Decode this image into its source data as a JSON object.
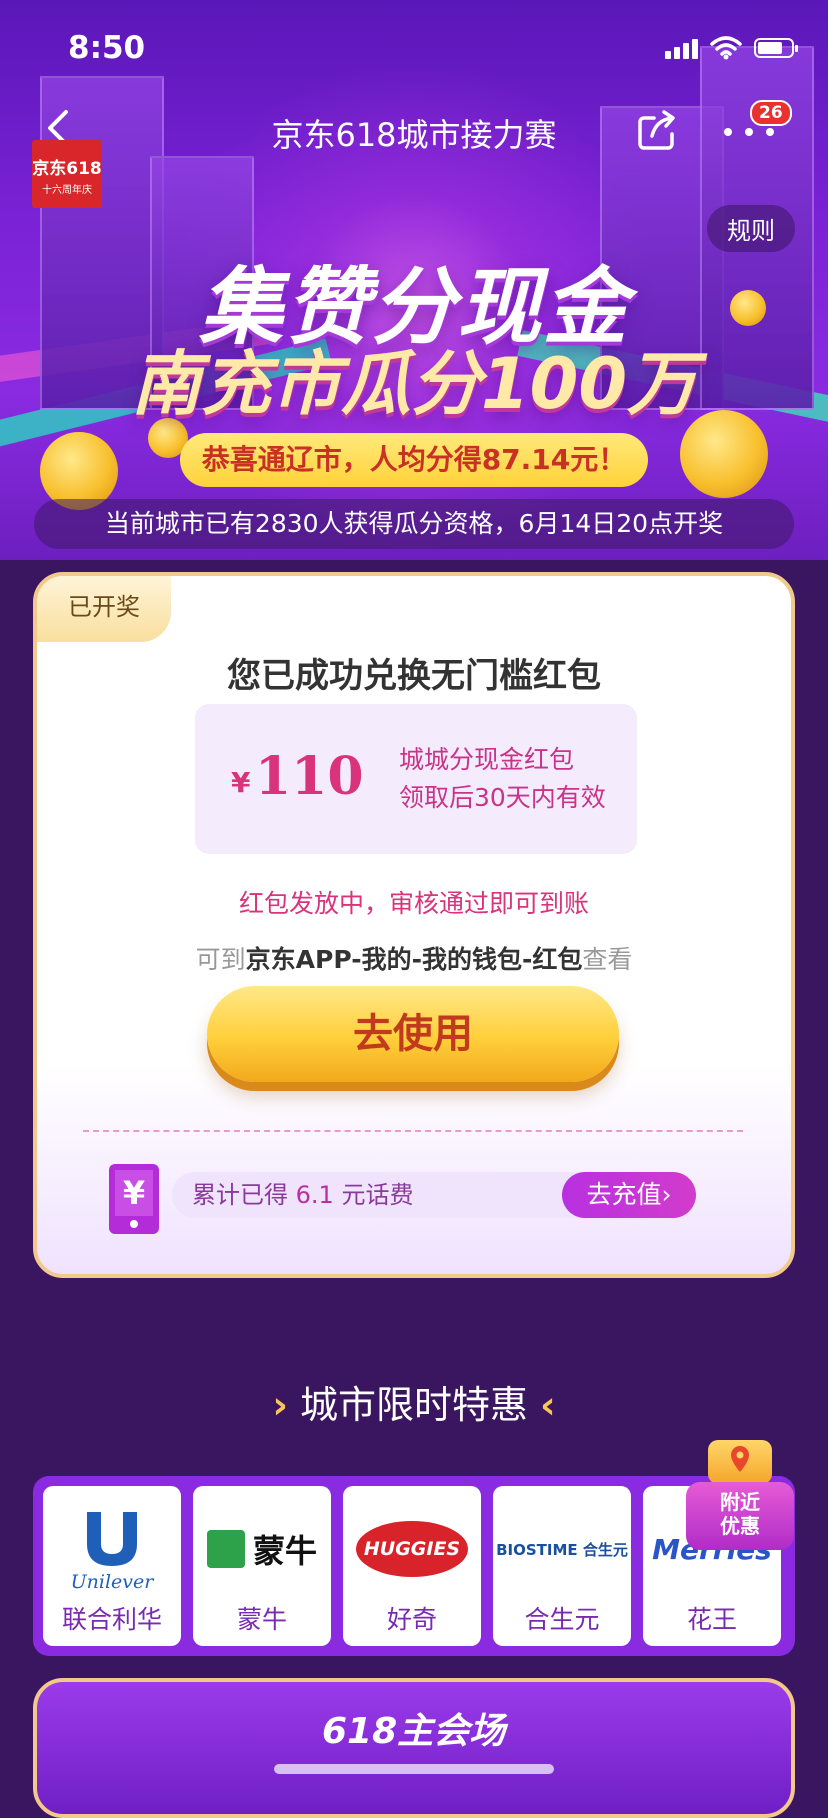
{
  "status_bar": {
    "time": "8:50"
  },
  "nav": {
    "title": "京东618城市接力赛",
    "logo_line1": "京东618",
    "logo_line2": "十六周年庆",
    "badge_count": "26",
    "rules_label": "规则"
  },
  "hero": {
    "headline1": "集赞分现金",
    "headline2": "南充市瓜分100万",
    "congrats": "恭喜通辽市，人均分得87.14元！",
    "info": "当前城市已有2830人获得瓜分资格，6月14日20点开奖"
  },
  "card": {
    "tag": "已开奖",
    "title": "您已成功兑换无门槛红包",
    "coupon": {
      "currency": "¥",
      "amount": "110",
      "name": "城城分现金红包",
      "validity": "领取后30天内有效"
    },
    "issuing_note": "红包发放中，审核通过即可到账",
    "path_prefix": "可到",
    "path": "京东APP-我的-我的钱包-红包",
    "path_suffix": "查看",
    "use_button": "去使用",
    "bill_prefix": "累计已得",
    "bill_amount": "6.1",
    "bill_suffix": "元话费",
    "recharge_button": "去充值",
    "phone_glyph": "¥"
  },
  "deals": {
    "title": "城市限时特惠",
    "brands": [
      {
        "name": "联合利华",
        "logo_text": "Unilever"
      },
      {
        "name": "蒙牛",
        "logo_text": "蒙牛"
      },
      {
        "name": "好奇",
        "logo_text": "HUGGIES"
      },
      {
        "name": "合生元",
        "logo_text": "BIOSTIME 合生元"
      },
      {
        "name": "花王",
        "logo_text": "Merries"
      }
    ],
    "nearby_line1": "附近",
    "nearby_line2": "优惠"
  },
  "next_section": {
    "title": "618主会场"
  },
  "colors": {
    "accent_pink": "#d9337c",
    "accent_purple": "#8a2be2",
    "button_gold": "#ffcf3a",
    "page_bg": "#3a1660"
  },
  "icons": [
    "back-arrow-icon",
    "share-icon",
    "more-icon",
    "phone-money-icon",
    "chevron-right-icon",
    "location-pin-icon"
  ]
}
